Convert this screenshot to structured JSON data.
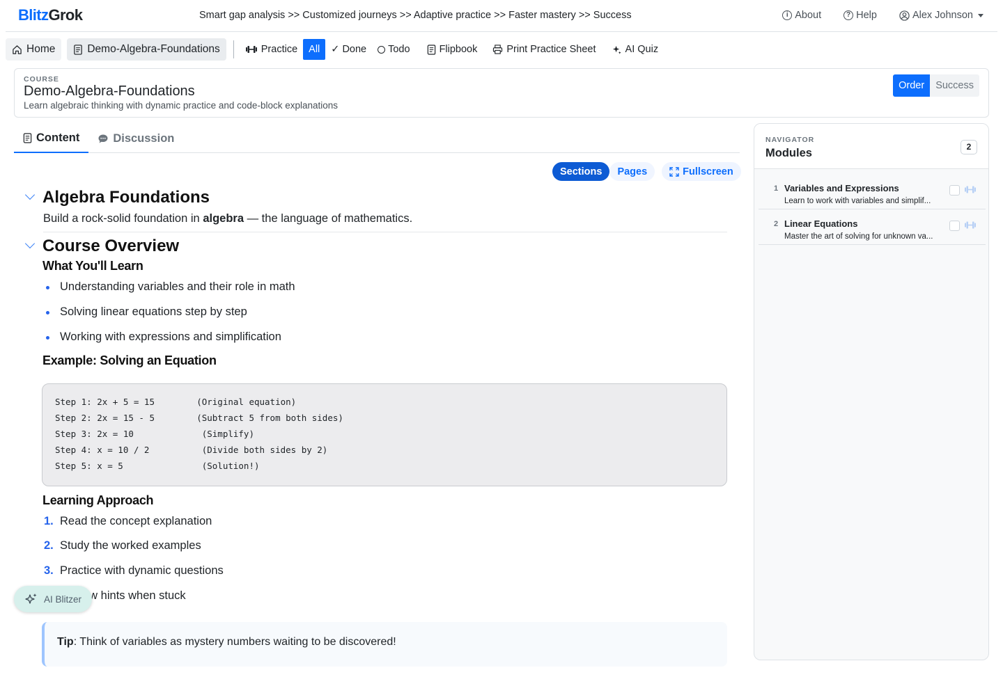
{
  "app": {
    "brand_part1": "Blitz",
    "brand_part2": "Grok",
    "tagline": "Smart gap analysis >> Customized journeys >> Adaptive practice >> Faster mastery >> Success",
    "accent": "#0d6efd"
  },
  "topnav": {
    "about": "About",
    "help": "Help",
    "user": "Alex Johnson"
  },
  "toolbar": {
    "home": "Home",
    "course": "Demo-Algebra-Foundations",
    "practice": "Practice",
    "filter": {
      "all": "All",
      "done": "Done",
      "todo": "Todo",
      "selected": "All"
    },
    "flipbook": "Flipbook",
    "print": "Print Practice Sheet",
    "ai_quiz": "AI Quiz"
  },
  "course": {
    "kicker": "COURSE",
    "title": "Demo-Algebra-Foundations",
    "subtitle": "Learn algebraic thinking with dynamic practice and code-block explanations",
    "mode_toggle": {
      "order": "Order",
      "success": "Success",
      "selected": "Order"
    }
  },
  "tabs": {
    "content": "Content",
    "discussion": "Discussion",
    "selected": "Content"
  },
  "view": {
    "sections": "Sections",
    "pages": "Pages",
    "fullscreen": "Fullscreen",
    "selected": "Sections"
  },
  "content": {
    "section1": {
      "title": "Algebra Foundations",
      "lead_pre": "Build a rock-solid foundation in ",
      "lead_bold": "algebra",
      "lead_post": " — the language of mathematics."
    },
    "section2": {
      "title": "Course Overview",
      "learn_heading": "What You'll Learn",
      "learn_items": [
        "Understanding variables and their role in math",
        "Solving linear equations step by step",
        "Working with expressions and simplification"
      ],
      "example_heading": "Example: Solving an Equation",
      "code_lines": [
        "Step 1: 2x + 5 = 15        (Original equation)",
        "Step 2: 2x = 15 - 5        (Subtract 5 from both sides)",
        "Step 3: 2x = 10             (Simplify)",
        "Step 4: x = 10 / 2          (Divide both sides by 2)",
        "Step 5: x = 5               (Solution!)"
      ],
      "approach_heading": "Learning Approach",
      "approach_items": [
        "Read the concept explanation",
        "Study the worked examples",
        "Practice with dynamic questions",
        "Review hints when stuck"
      ],
      "tip_label": "Tip",
      "tip_text": ": Think of variables as mystery numbers waiting to be discovered!"
    }
  },
  "ai_button": "AI Blitzer",
  "navigator": {
    "kicker": "NAVIGATOR",
    "title": "Modules",
    "count": "2",
    "modules": [
      {
        "num": "1",
        "title": "Variables and Expressions",
        "desc": "Learn to work with variables and simplif..."
      },
      {
        "num": "2",
        "title": "Linear Equations",
        "desc": "Master the art of solving for unknown va..."
      }
    ]
  }
}
